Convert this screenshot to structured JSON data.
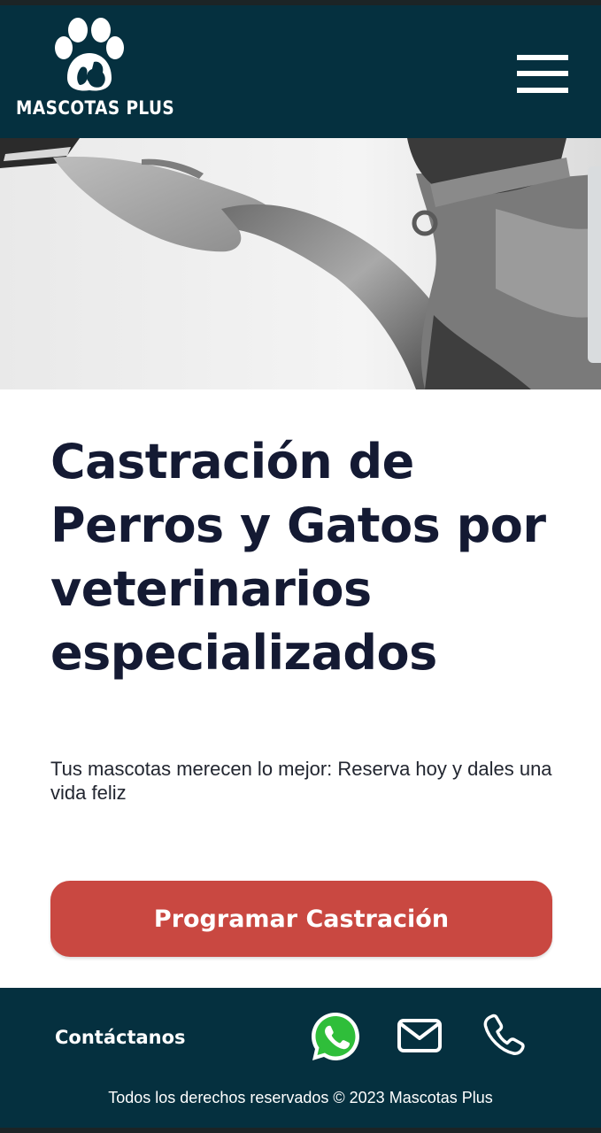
{
  "header": {
    "brand_name": "MASCOTAS PLUS",
    "logo_icon": "paw-pet-icon",
    "menu_icon": "hamburger-menu-icon"
  },
  "hero": {
    "image_description": "grayscale-hand-shaking-dog-paw"
  },
  "main": {
    "headline": "Castración de Perros y Gatos por veterinarios especializados",
    "subtitle": "Tus mascotas merecen lo mejor: Reserva hoy y dales una vida feliz",
    "cta_label": "Programar Castración"
  },
  "footer": {
    "contact_label": "Contáctanos",
    "icons": [
      "whatsapp-icon",
      "mail-icon",
      "phone-icon"
    ],
    "copyright": "Todos los derechos reservados © 2023 Mascotas Plus"
  },
  "colors": {
    "header_bg": "#05303f",
    "headline": "#141a33",
    "cta_bg": "#c94841",
    "whatsapp_green": "#2fbe3a"
  }
}
